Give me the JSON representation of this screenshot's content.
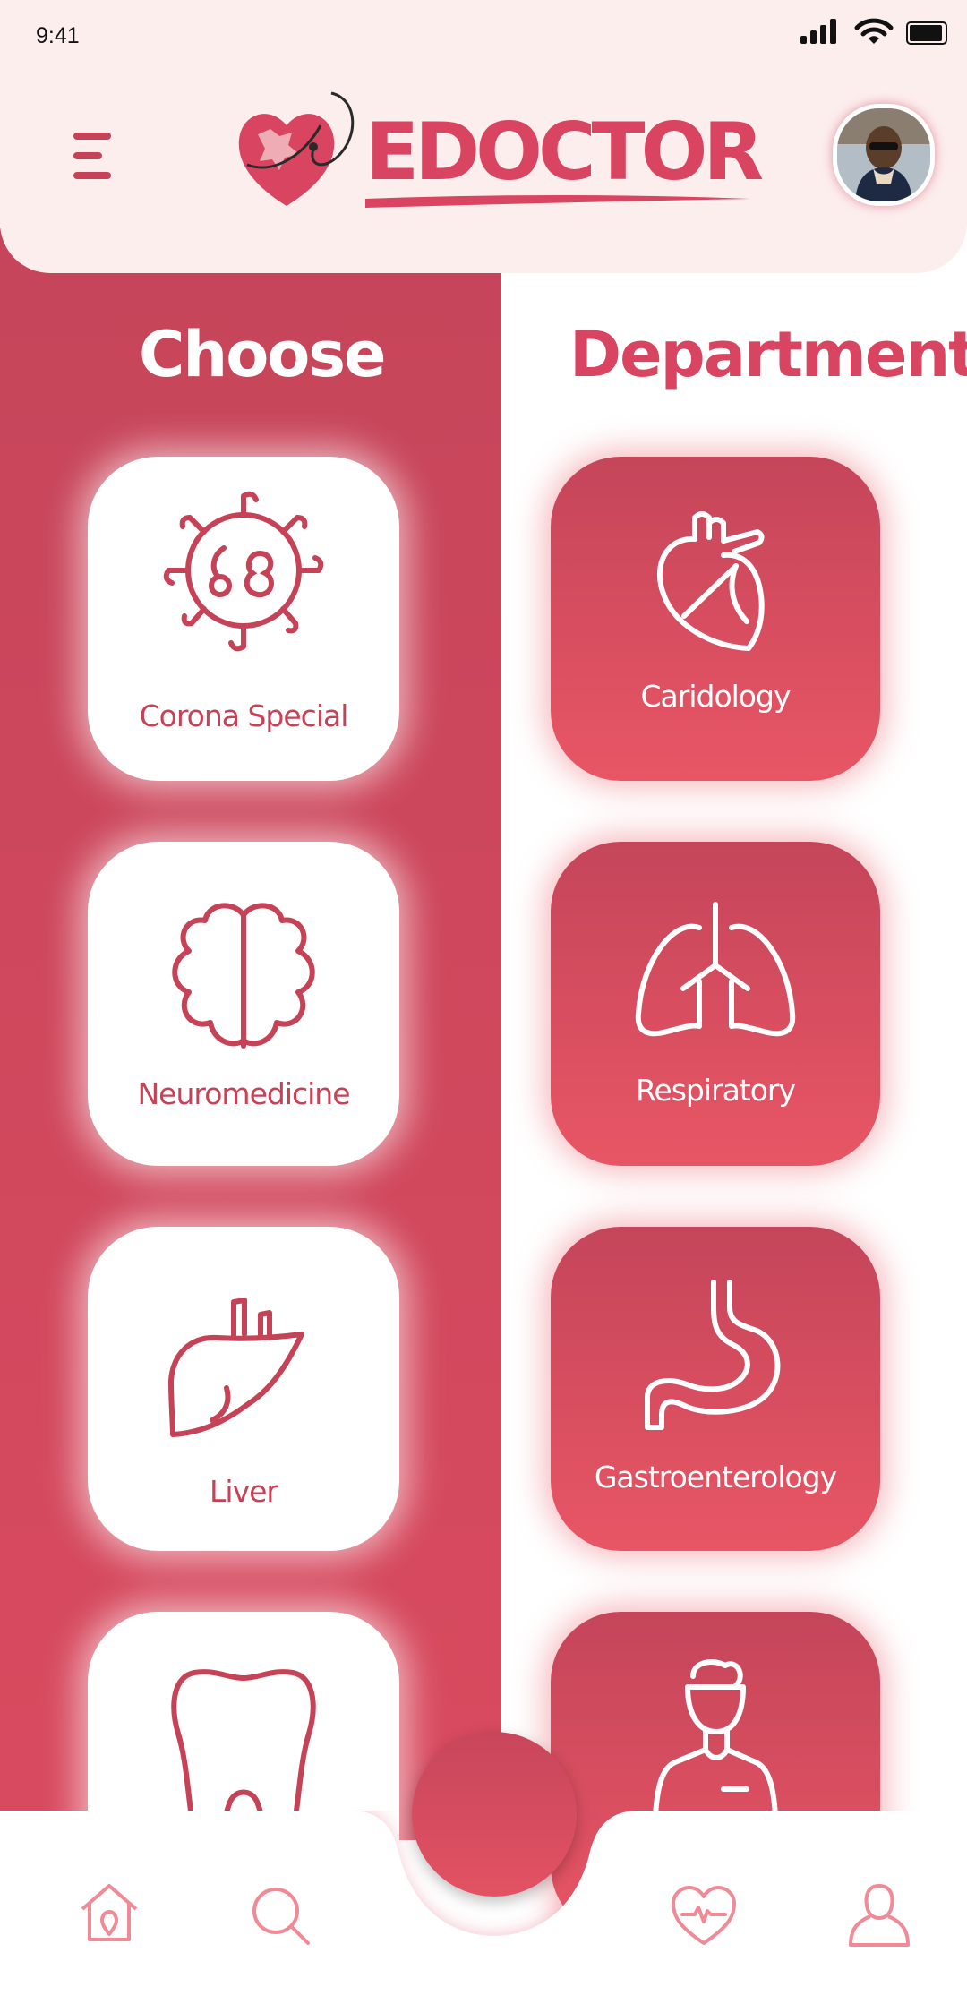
{
  "status_bar": {
    "time": "9:41"
  },
  "header": {
    "brand": "EDOCTOR"
  },
  "columns": {
    "left_title": "Choose",
    "right_title": "Department"
  },
  "departments": [
    {
      "label": "Corona Special",
      "icon": "virus-icon"
    },
    {
      "label": "Caridology",
      "icon": "heart-organ-icon"
    },
    {
      "label": "Neuromedicine",
      "icon": "brain-icon"
    },
    {
      "label": "Respiratory",
      "icon": "lungs-icon"
    },
    {
      "label": "Liver",
      "icon": "liver-icon"
    },
    {
      "label": "Gastroenterology",
      "icon": "stomach-icon"
    },
    {
      "label": "",
      "icon": "tooth-icon"
    },
    {
      "label": "",
      "icon": "nurse-icon"
    }
  ],
  "nav": {
    "items": [
      "home-icon",
      "search-icon",
      "heart-pulse-icon",
      "user-icon"
    ]
  },
  "colors": {
    "accent": "#d94460",
    "accent_dark": "#c64256",
    "header_bg": "#fdeeee",
    "white": "#ffffff"
  }
}
